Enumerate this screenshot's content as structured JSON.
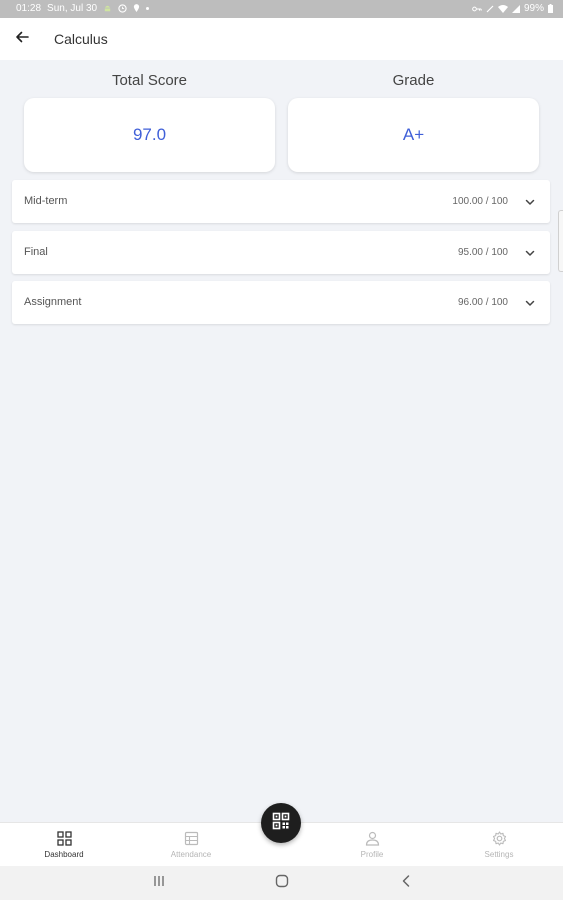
{
  "status_bar": {
    "time": "01:28",
    "date": "Sun, Jul 30",
    "battery": "99%"
  },
  "app_bar": {
    "title": "Calculus",
    "back_icon": "arrow-left-icon"
  },
  "summary": {
    "total_score_label": "Total Score",
    "total_score_value": "97.0",
    "grade_label": "Grade",
    "grade_value": "A+",
    "accent_color": "#3f5fd8"
  },
  "scores": [
    {
      "name": "Mid-term",
      "score": "100.00 / 100"
    },
    {
      "name": "Final",
      "score": "95.00 / 100"
    },
    {
      "name": "Assignment",
      "score": "96.00 / 100"
    }
  ],
  "bottom_nav": {
    "items": [
      {
        "label": "Dashboard",
        "icon": "dashboard-icon",
        "active": true
      },
      {
        "label": "Attendance",
        "icon": "attendance-icon",
        "active": false
      },
      {
        "label": "Profile",
        "icon": "profile-icon",
        "active": false
      },
      {
        "label": "Settings",
        "icon": "settings-icon",
        "active": false
      }
    ],
    "fab_icon": "qr-code-icon"
  },
  "system_nav": {
    "recents_icon": "recents-icon",
    "home_icon": "home-icon",
    "back_icon": "back-icon"
  }
}
